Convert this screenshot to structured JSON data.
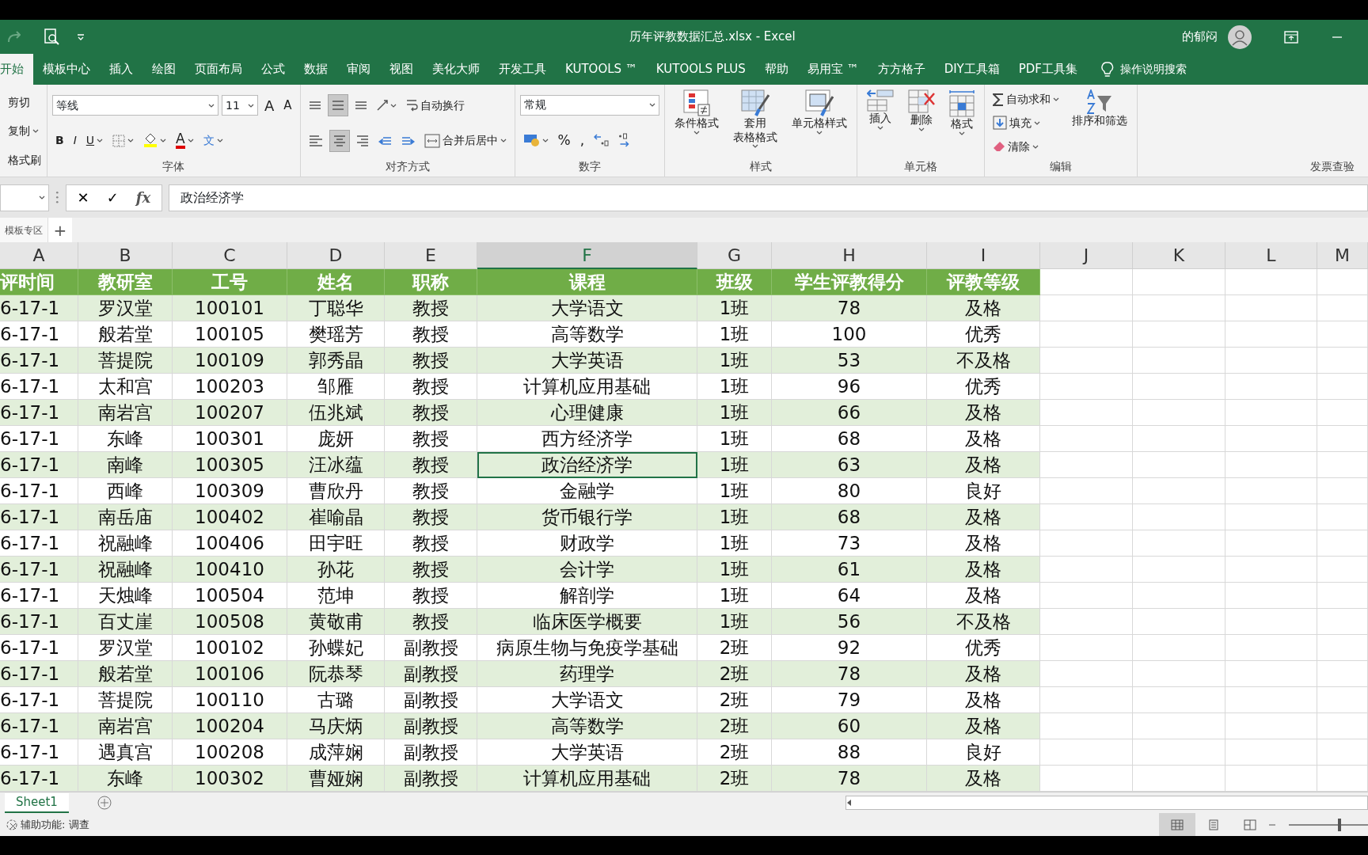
{
  "window": {
    "title": "历年评教数据汇总.xlsx  -  Excel",
    "user": "的郁闷"
  },
  "tabs": [
    {
      "label": "开始",
      "selected": true
    },
    {
      "label": "模板中心",
      "selected": false
    },
    {
      "label": "插入",
      "selected": false
    },
    {
      "label": "绘图",
      "selected": false
    },
    {
      "label": "页面布局",
      "selected": false
    },
    {
      "label": "公式",
      "selected": false
    },
    {
      "label": "数据",
      "selected": false
    },
    {
      "label": "审阅",
      "selected": false
    },
    {
      "label": "视图",
      "selected": false
    },
    {
      "label": "美化大师",
      "selected": false
    },
    {
      "label": "开发工具",
      "selected": false
    },
    {
      "label": "KUTOOLS ™",
      "selected": false
    },
    {
      "label": "KUTOOLS PLUS",
      "selected": false
    },
    {
      "label": "帮助",
      "selected": false
    },
    {
      "label": "易用宝 ™",
      "selected": false
    },
    {
      "label": "方方格子",
      "selected": false
    },
    {
      "label": "DIY工具箱",
      "selected": false
    },
    {
      "label": "PDF工具集",
      "selected": false
    }
  ],
  "tell_me": "操作说明搜索",
  "ribbon": [
    {
      "blocks": [
        {
          "kind": "stack",
          "lines": [
            {
              "items": [
                {
                  "kind": "button",
                  "label": "剪切"
                }
              ]
            },
            {
              "items": [
                {
                  "kind": "split",
                  "label": "复制"
                }
              ]
            },
            {
              "items": [
                {
                  "kind": "button",
                  "label": "格式刷"
                }
              ]
            }
          ]
        }
      ]
    },
    {
      "label": "字体",
      "blocks": [
        {
          "kind": "stack",
          "lines": [
            {
              "items": [
                {
                  "kind": "field",
                  "label": "等线"
                },
                {
                  "kind": "field",
                  "label": "11"
                },
                {
                  "kind": "button",
                  "label": "A"
                },
                {
                  "kind": "button",
                  "label": "A"
                }
              ]
            },
            {
              "items": [
                {
                  "kind": "button",
                  "label": "B"
                },
                {
                  "kind": "button",
                  "label": "I"
                },
                {
                  "kind": "split",
                  "label": "U"
                },
                {
                  "kind": "split"
                },
                {
                  "kind": "split"
                },
                {
                  "kind": "split",
                  "label": "A"
                },
                {
                  "kind": "split",
                  "label": "文"
                }
              ]
            }
          ]
        }
      ]
    },
    {
      "label": "对齐方式",
      "blocks": [
        {
          "kind": "stack",
          "lines": [
            {
              "items": [
                {
                  "kind": "toggle",
                  "selected": false
                },
                {
                  "kind": "toggle",
                  "selected": true
                },
                {
                  "kind": "toggle",
                  "selected": false
                },
                {
                  "kind": "split"
                },
                {
                  "kind": "button",
                  "label": "自动换行"
                }
              ]
            },
            {
              "items": [
                {
                  "kind": "toggle",
                  "selected": false
                },
                {
                  "kind": "toggle",
                  "selected": true
                },
                {
                  "kind": "toggle",
                  "selected": false
                },
                {
                  "kind": "button"
                },
                {
                  "kind": "button"
                },
                {
                  "kind": "split",
                  "label": "合并后居中"
                }
              ]
            }
          ]
        }
      ]
    },
    {
      "label": "数字",
      "blocks": [
        {
          "kind": "stack",
          "lines": [
            {
              "items": [
                {
                  "kind": "field",
                  "label": "常规"
                }
              ]
            },
            {
              "items": [
                {
                  "kind": "split"
                },
                {
                  "kind": "button",
                  "label": "%"
                },
                {
                  "kind": "button",
                  "label": ","
                },
                {
                  "kind": "button"
                },
                {
                  "kind": "button"
                }
              ]
            }
          ]
        }
      ]
    },
    {
      "label": "样式",
      "blocks": [
        {
          "kind": "large",
          "lines": [
            "条件格式"
          ]
        },
        {
          "kind": "large",
          "lines": [
            "套用",
            "表格格式"
          ]
        },
        {
          "kind": "large",
          "lines": [
            "单元格样式"
          ]
        }
      ]
    },
    {
      "label": "单元格",
      "blocks": [
        {
          "kind": "large",
          "lines": [
            "插入"
          ]
        },
        {
          "kind": "large",
          "lines": [
            "删除"
          ]
        },
        {
          "kind": "large",
          "lines": [
            "格式"
          ]
        }
      ]
    },
    {
      "label": "编辑",
      "blocks": [
        {
          "kind": "stack",
          "lines": [
            {
              "items": [
                {
                  "kind": "split",
                  "label": "自动求和"
                }
              ]
            },
            {
              "items": [
                {
                  "kind": "split",
                  "label": "填充"
                }
              ]
            },
            {
              "items": [
                {
                  "kind": "split",
                  "label": "清除"
                }
              ]
            }
          ]
        },
        {
          "kind": "large",
          "lines": [
            "排序和筛选"
          ]
        }
      ]
    },
    {
      "label": "发票查验"
    }
  ],
  "formula_bar": {
    "cancel": "✕",
    "enter": "✓",
    "fx": "fx",
    "value": "政治经济学"
  },
  "template_tab": {
    "label": "模板专区",
    "add": "+"
  },
  "columns": [
    {
      "label": "A",
      "selected": false
    },
    {
      "label": "B",
      "selected": false
    },
    {
      "label": "C",
      "selected": false
    },
    {
      "label": "D",
      "selected": false
    },
    {
      "label": "E",
      "selected": false
    },
    {
      "label": "F",
      "selected": true
    },
    {
      "label": "G",
      "selected": false
    },
    {
      "label": "H",
      "selected": false
    },
    {
      "label": "I",
      "selected": false
    },
    {
      "label": "J",
      "selected": false
    },
    {
      "label": "K",
      "selected": false
    },
    {
      "label": "L",
      "selected": false
    },
    {
      "label": "M",
      "selected": false
    }
  ],
  "header": [
    "评时间",
    "教研室",
    "工号",
    "姓名",
    "职称",
    "课程",
    "班级",
    "学生评教得分",
    "评教等级"
  ],
  "rows": [
    {
      "cells": [
        "6-17-1",
        "罗汉堂",
        "100101",
        "丁聪华",
        "教授",
        "大学语文",
        "1班",
        "78",
        "及格"
      ],
      "selected": false
    },
    {
      "cells": [
        "6-17-1",
        "般若堂",
        "100105",
        "樊瑶芳",
        "教授",
        "高等数学",
        "1班",
        "100",
        "优秀"
      ],
      "selected": false
    },
    {
      "cells": [
        "6-17-1",
        "菩提院",
        "100109",
        "郭秀晶",
        "教授",
        "大学英语",
        "1班",
        "53",
        "不及格"
      ],
      "selected": false
    },
    {
      "cells": [
        "6-17-1",
        "太和宫",
        "100203",
        "邹雁",
        "教授",
        "计算机应用基础",
        "1班",
        "96",
        "优秀"
      ],
      "selected": false
    },
    {
      "cells": [
        "6-17-1",
        "南岩宫",
        "100207",
        "伍兆斌",
        "教授",
        "心理健康",
        "1班",
        "66",
        "及格"
      ],
      "selected": false
    },
    {
      "cells": [
        "6-17-1",
        "东峰",
        "100301",
        "庞妍",
        "教授",
        "西方经济学",
        "1班",
        "68",
        "及格"
      ],
      "selected": false
    },
    {
      "cells": [
        "6-17-1",
        "南峰",
        "100305",
        "汪冰蕴",
        "教授",
        "政治经济学",
        "1班",
        "63",
        "及格"
      ],
      "selected": true
    },
    {
      "cells": [
        "6-17-1",
        "西峰",
        "100309",
        "曹欣丹",
        "教授",
        "金融学",
        "1班",
        "80",
        "良好"
      ],
      "selected": false
    },
    {
      "cells": [
        "6-17-1",
        "南岳庙",
        "100402",
        "崔喻晶",
        "教授",
        "货币银行学",
        "1班",
        "68",
        "及格"
      ],
      "selected": false
    },
    {
      "cells": [
        "6-17-1",
        "祝融峰",
        "100406",
        "田宇旺",
        "教授",
        "财政学",
        "1班",
        "73",
        "及格"
      ],
      "selected": false
    },
    {
      "cells": [
        "6-17-1",
        "祝融峰",
        "100410",
        "孙花",
        "教授",
        "会计学",
        "1班",
        "61",
        "及格"
      ],
      "selected": false
    },
    {
      "cells": [
        "6-17-1",
        "天烛峰",
        "100504",
        "范坤",
        "教授",
        "解剖学",
        "1班",
        "64",
        "及格"
      ],
      "selected": false
    },
    {
      "cells": [
        "6-17-1",
        "百丈崖",
        "100508",
        "黄敬甫",
        "教授",
        "临床医学概要",
        "1班",
        "56",
        "不及格"
      ],
      "selected": false
    },
    {
      "cells": [
        "6-17-1",
        "罗汉堂",
        "100102",
        "孙蝶妃",
        "副教授",
        "病原生物与免疫学基础",
        "2班",
        "92",
        "优秀"
      ],
      "selected": false
    },
    {
      "cells": [
        "6-17-1",
        "般若堂",
        "100106",
        "阮恭琴",
        "副教授",
        "药理学",
        "2班",
        "78",
        "及格"
      ],
      "selected": false
    },
    {
      "cells": [
        "6-17-1",
        "菩提院",
        "100110",
        "古璐",
        "副教授",
        "大学语文",
        "2班",
        "79",
        "及格"
      ],
      "selected": false
    },
    {
      "cells": [
        "6-17-1",
        "南岩宫",
        "100204",
        "马庆炳",
        "副教授",
        "高等数学",
        "2班",
        "60",
        "及格"
      ],
      "selected": false
    },
    {
      "cells": [
        "6-17-1",
        "遇真宫",
        "100208",
        "成萍娴",
        "副教授",
        "大学英语",
        "2班",
        "88",
        "良好"
      ],
      "selected": false
    },
    {
      "cells": [
        "6-17-1",
        "东峰",
        "100302",
        "曹娅娴",
        "副教授",
        "计算机应用基础",
        "2班",
        "78",
        "及格"
      ],
      "selected": false
    }
  ],
  "sheet_tabs": [
    {
      "label": "Sheet1",
      "selected": true
    }
  ],
  "status_bar": {
    "accessibility": "辅助功能: 调查",
    "views": [
      {
        "selected": true
      },
      {
        "selected": false
      },
      {
        "selected": false
      }
    ],
    "zoom": {
      "level": 0.65
    }
  }
}
